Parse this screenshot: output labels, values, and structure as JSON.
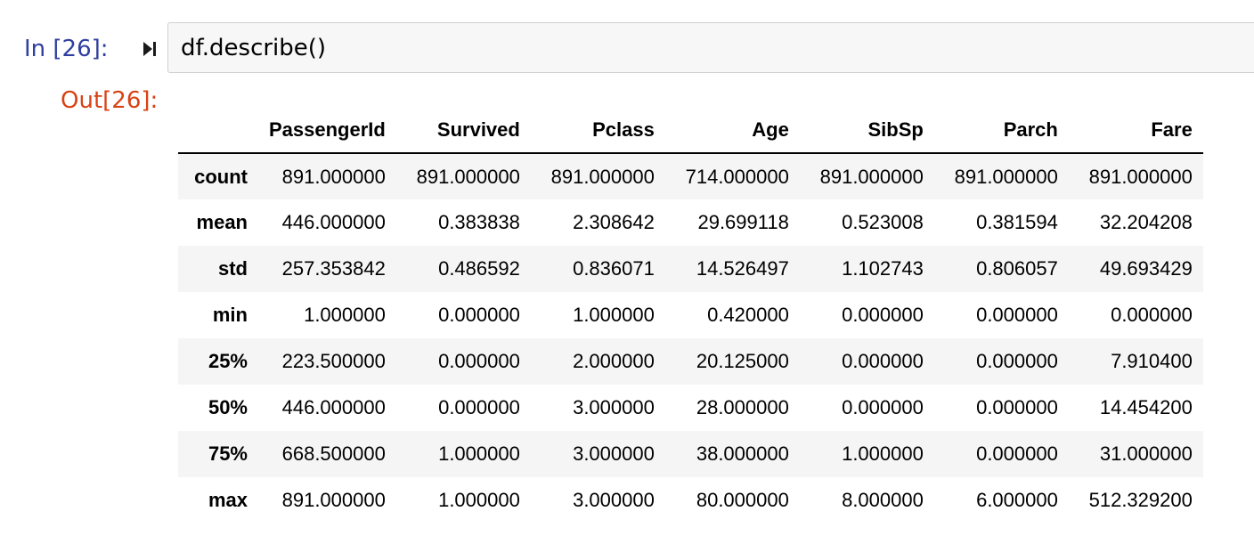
{
  "cell": {
    "in_prompt": "In [26]:",
    "code": "df.describe()",
    "out_prompt": "Out[26]:"
  },
  "table": {
    "columns": [
      "PassengerId",
      "Survived",
      "Pclass",
      "Age",
      "SibSp",
      "Parch",
      "Fare"
    ],
    "rows": [
      {
        "label": "count",
        "values": [
          "891.000000",
          "891.000000",
          "891.000000",
          "714.000000",
          "891.000000",
          "891.000000",
          "891.000000"
        ]
      },
      {
        "label": "mean",
        "values": [
          "446.000000",
          "0.383838",
          "2.308642",
          "29.699118",
          "0.523008",
          "0.381594",
          "32.204208"
        ]
      },
      {
        "label": "std",
        "values": [
          "257.353842",
          "0.486592",
          "0.836071",
          "14.526497",
          "1.102743",
          "0.806057",
          "49.693429"
        ]
      },
      {
        "label": "min",
        "values": [
          "1.000000",
          "0.000000",
          "1.000000",
          "0.420000",
          "0.000000",
          "0.000000",
          "0.000000"
        ]
      },
      {
        "label": "25%",
        "values": [
          "223.500000",
          "0.000000",
          "2.000000",
          "20.125000",
          "0.000000",
          "0.000000",
          "7.910400"
        ]
      },
      {
        "label": "50%",
        "values": [
          "446.000000",
          "0.000000",
          "3.000000",
          "28.000000",
          "0.000000",
          "0.000000",
          "14.454200"
        ]
      },
      {
        "label": "75%",
        "values": [
          "668.500000",
          "1.000000",
          "3.000000",
          "38.000000",
          "1.000000",
          "0.000000",
          "31.000000"
        ]
      },
      {
        "label": "max",
        "values": [
          "891.000000",
          "1.000000",
          "3.000000",
          "80.000000",
          "8.000000",
          "6.000000",
          "512.329200"
        ]
      }
    ]
  },
  "icons": {
    "run": "run-step-icon"
  },
  "colors": {
    "in_prompt": "#303f9f",
    "out_prompt": "#d84315",
    "input_bg": "#f7f7f7",
    "row_stripe": "#f5f5f5"
  }
}
